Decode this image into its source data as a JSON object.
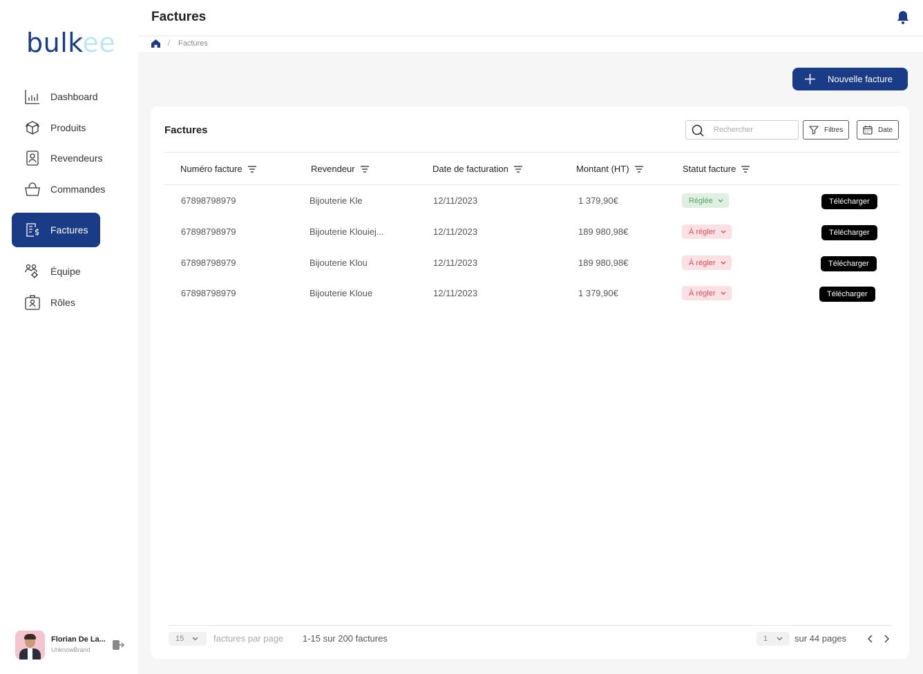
{
  "brand": {
    "logo_main": "bulk",
    "logo_accent": "ee"
  },
  "sidebar": {
    "items": [
      {
        "label": "Dashboard",
        "icon": "chart-icon"
      },
      {
        "label": "Produits",
        "icon": "box-icon"
      },
      {
        "label": "Revendeurs",
        "icon": "contact-card-icon"
      },
      {
        "label": "Commandes",
        "icon": "basket-icon"
      },
      {
        "label": "Factures",
        "icon": "invoice-icon",
        "active": true
      },
      {
        "label": "Équipe",
        "icon": "team-icon"
      },
      {
        "label": "Rôles",
        "icon": "badge-icon"
      }
    ]
  },
  "user": {
    "name": "Florian De La...",
    "brand": "UnknowBrand"
  },
  "header": {
    "title": "Factures"
  },
  "breadcrumb": {
    "separator": "/",
    "current": "Factures"
  },
  "actions": {
    "new_invoice": "Nouvelle facture"
  },
  "card": {
    "title": "Factures",
    "search_placeholder": "Rechercher",
    "filters_label": "Filtres",
    "date_label": "Date"
  },
  "table": {
    "columns": [
      "Numéro facture",
      "Revendeur",
      "Date de facturation",
      "Montant (HT)",
      "Statut facture"
    ],
    "rows": [
      {
        "number": "67898798979",
        "reseller": "Bijouterie Kle",
        "date": "12/11/2023",
        "amount": "1 379,90€",
        "status": "Réglée",
        "status_type": "ok",
        "action": "Télécharger"
      },
      {
        "number": "67898798979",
        "reseller": "Bijouterie Klouiej...",
        "date": "12/11/2023",
        "amount": "189 980,98€",
        "status": "À régler",
        "status_type": "due",
        "action": "Télécharger"
      },
      {
        "number": "67898798979",
        "reseller": "Bijouterie Klou",
        "date": "12/11/2023",
        "amount": "189 980,98€",
        "status": "À régler",
        "status_type": "due",
        "action": "Télécharger"
      },
      {
        "number": "67898798979",
        "reseller": "Bijouterie Kloue",
        "date": "12/11/2023",
        "amount": "1 379,90€",
        "status": "À régler",
        "status_type": "due",
        "action": "Télécharger"
      }
    ]
  },
  "pagination": {
    "per_page": "15",
    "per_page_label": "factures par page",
    "range": "1-15 sur 200 factures",
    "current_page": "1",
    "pages_label": "sur 44 pages"
  },
  "colors": {
    "primary": "#1a3c86",
    "logo_accent": "#bfe6f5",
    "ok_bg": "#dff0e2",
    "ok_text": "#5d9c66",
    "due_bg": "#fbe1e3",
    "due_text": "#d0505c"
  }
}
